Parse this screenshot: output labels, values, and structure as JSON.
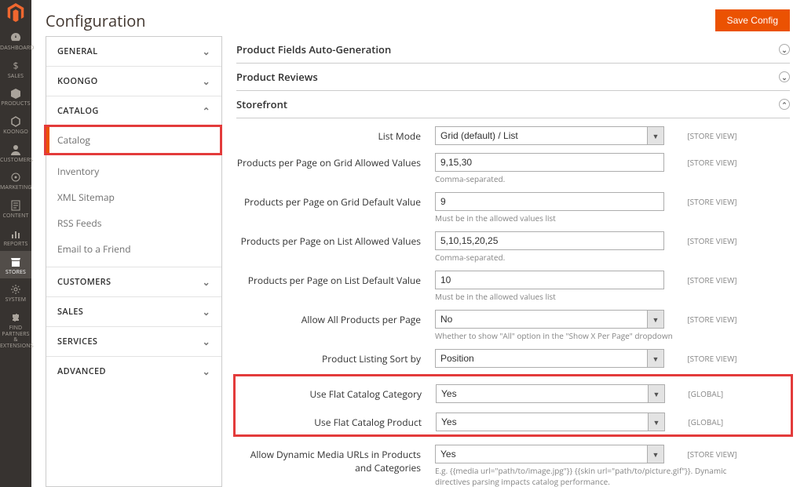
{
  "page": {
    "title": "Configuration",
    "save": "Save Config"
  },
  "adminNav": [
    {
      "name": "dashboard",
      "label": "DASHBOARD"
    },
    {
      "name": "sales",
      "label": "SALES"
    },
    {
      "name": "products",
      "label": "PRODUCTS"
    },
    {
      "name": "koongo",
      "label": "KOONGO"
    },
    {
      "name": "customers",
      "label": "CUSTOMERS"
    },
    {
      "name": "marketing",
      "label": "MARKETING"
    },
    {
      "name": "content",
      "label": "CONTENT"
    },
    {
      "name": "reports",
      "label": "REPORTS"
    },
    {
      "name": "stores",
      "label": "STORES",
      "active": true
    },
    {
      "name": "system",
      "label": "SYSTEM"
    },
    {
      "name": "find-partners",
      "label": "FIND PARTNERS & EXTENSIONS"
    }
  ],
  "configNav": {
    "groups": [
      {
        "key": "general",
        "label": "GENERAL",
        "chev": "v"
      },
      {
        "key": "koongo",
        "label": "KOONGO",
        "chev": "v"
      },
      {
        "key": "catalog",
        "label": "CATALOG",
        "chev": "^",
        "open": true,
        "items": [
          {
            "key": "catalog",
            "label": "Catalog",
            "active": true
          },
          {
            "key": "inventory",
            "label": "Inventory"
          },
          {
            "key": "xml-sitemap",
            "label": "XML Sitemap"
          },
          {
            "key": "rss-feeds",
            "label": "RSS Feeds"
          },
          {
            "key": "email-to-friend",
            "label": "Email to a Friend"
          }
        ]
      },
      {
        "key": "customers",
        "label": "CUSTOMERS",
        "chev": "v"
      },
      {
        "key": "sales",
        "label": "SALES",
        "chev": "v"
      },
      {
        "key": "services",
        "label": "SERVICES",
        "chev": "v"
      },
      {
        "key": "advanced",
        "label": "ADVANCED",
        "chev": "v"
      }
    ]
  },
  "sections": {
    "autoGen": "Product Fields Auto-Generation",
    "reviews": "Product Reviews",
    "storefront": "Storefront"
  },
  "fields": {
    "listMode": {
      "label": "List Mode",
      "value": "Grid (default) / List",
      "scope": "[STORE VIEW]"
    },
    "gridAllowed": {
      "label": "Products per Page on Grid Allowed Values",
      "value": "9,15,30",
      "note": "Comma-separated.",
      "scope": "[STORE VIEW]"
    },
    "gridDefault": {
      "label": "Products per Page on Grid Default Value",
      "value": "9",
      "note": "Must be in the allowed values list",
      "scope": "[STORE VIEW]"
    },
    "listAllowed": {
      "label": "Products per Page on List Allowed Values",
      "value": "5,10,15,20,25",
      "note": "Comma-separated.",
      "scope": "[STORE VIEW]"
    },
    "listDefault": {
      "label": "Products per Page on List Default Value",
      "value": "10",
      "note": "Must be in the allowed values list",
      "scope": "[STORE VIEW]"
    },
    "allowAll": {
      "label": "Allow All Products per Page",
      "value": "No",
      "note": "Whether to show \"All\" option in the \"Show X Per Page\" dropdown",
      "scope": "[STORE VIEW]"
    },
    "sortBy": {
      "label": "Product Listing Sort by",
      "value": "Position",
      "scope": "[STORE VIEW]"
    },
    "flatCategory": {
      "label": "Use Flat Catalog Category",
      "value": "Yes",
      "scope": "[GLOBAL]"
    },
    "flatProduct": {
      "label": "Use Flat Catalog Product",
      "value": "Yes",
      "scope": "[GLOBAL]"
    },
    "dynamicMedia": {
      "label": "Allow Dynamic Media URLs in Products and Categories",
      "value": "Yes",
      "note": "E.g. {{media url=\"path/to/image.jpg\"}} {{skin url=\"path/to/picture.gif\"}}. Dynamic directives parsing impacts catalog performance.",
      "scope": "[STORE VIEW]"
    }
  }
}
